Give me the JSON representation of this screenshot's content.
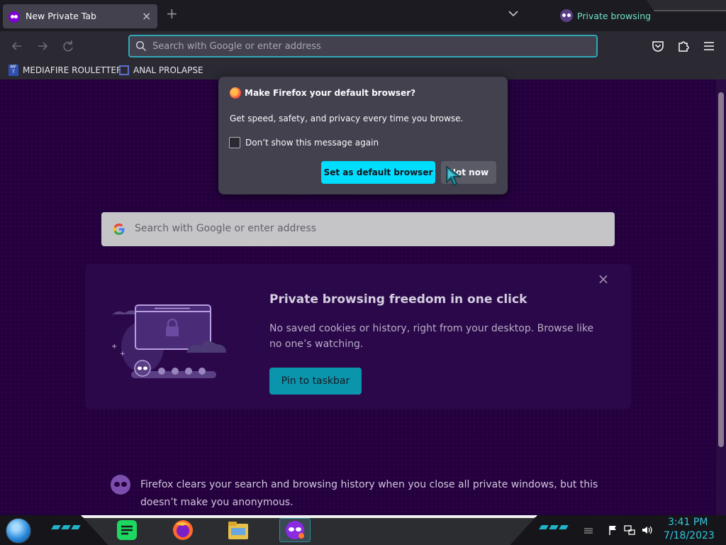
{
  "tab": {
    "title": "New Private Tab",
    "close": "×"
  },
  "tabstrip": {
    "new_tab": "+",
    "private_label": "Private browsing"
  },
  "urlbar": {
    "placeholder": "Search with Google or enter address"
  },
  "bookmarks": [
    {
      "label": "MEDIAFIRE ROULETTER",
      "icon_text": "MF T"
    },
    {
      "label": "ANAL PROLAPSE"
    }
  ],
  "dialog": {
    "title": "Make Firefox your default browser?",
    "body": "Get speed, safety, and privacy every time you browse.",
    "checkbox_label": "Don’t show this message again",
    "checkbox_checked": false,
    "primary_button": "Set as default browser",
    "secondary_button": "Not now"
  },
  "search": {
    "placeholder": "Search with Google or enter address"
  },
  "promo": {
    "title": "Private browsing freedom in one click",
    "text": "No saved cookies or history, right from your desktop. Browse like no one’s watching.",
    "button": "Pin to taskbar",
    "close": "×"
  },
  "footer": {
    "text": "Firefox clears your search and browsing history when you close all private windows, but this doesn’t make you anonymous."
  },
  "taskbar": {
    "apps": [
      "notes-app-icon",
      "firefox-icon",
      "file-explorer-icon",
      "firefox-private-icon"
    ],
    "clock_time": "3:41 PM",
    "clock_date": "7/18/2023"
  },
  "colors": {
    "accent": "#00ddff",
    "page_bg": "#25003e",
    "promo_button": "#0a95ad"
  }
}
